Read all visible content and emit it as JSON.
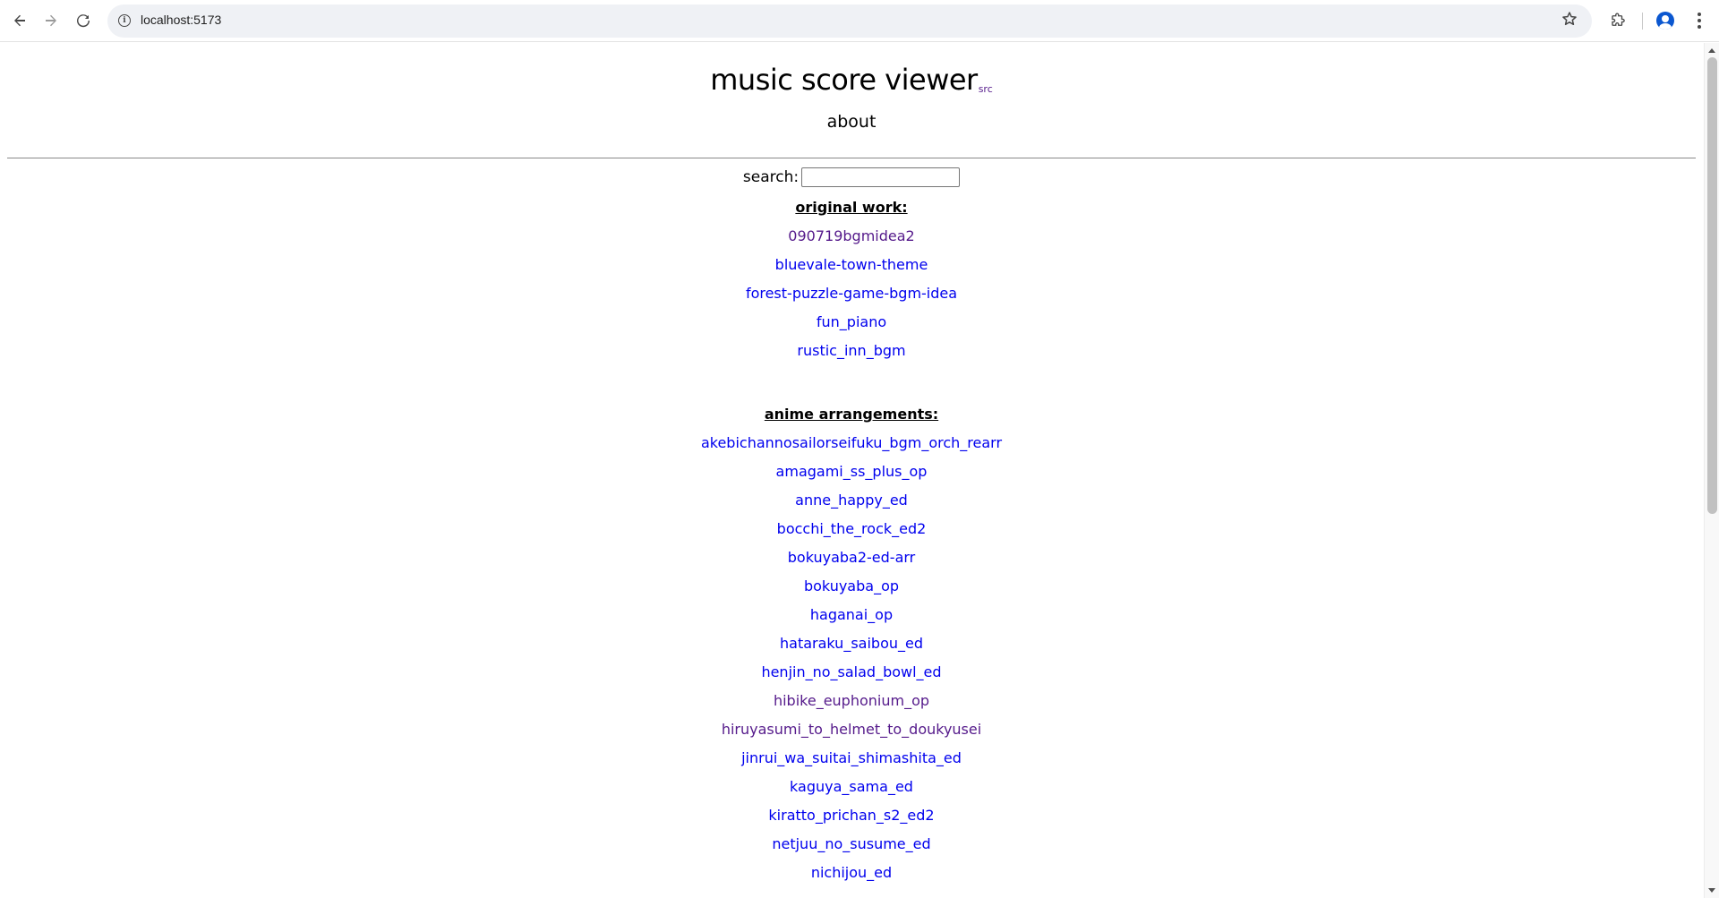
{
  "browser": {
    "url": "localhost:5173",
    "back_icon": "arrow-left-icon",
    "forward_icon": "arrow-right-icon",
    "reload_icon": "reload-icon",
    "bookmark_icon": "star-icon",
    "extensions_icon": "puzzle-icon",
    "profile_icon": "person-icon",
    "menu_icon": "kebab-icon"
  },
  "header": {
    "title": "music score viewer",
    "src_link": "src",
    "about_link": "about"
  },
  "search": {
    "label": "search:",
    "value": "",
    "placeholder": ""
  },
  "sections": [
    {
      "heading": "original work:",
      "items": [
        {
          "label": "090719bgmidea2",
          "visited": true
        },
        {
          "label": "bluevale-town-theme",
          "visited": false
        },
        {
          "label": "forest-puzzle-game-bgm-idea",
          "visited": false
        },
        {
          "label": "fun_piano",
          "visited": false
        },
        {
          "label": "rustic_inn_bgm",
          "visited": false
        }
      ]
    },
    {
      "heading": "anime arrangements:",
      "items": [
        {
          "label": "akebichannosailorseifuku_bgm_orch_rearr",
          "visited": false
        },
        {
          "label": "amagami_ss_plus_op",
          "visited": false
        },
        {
          "label": "anne_happy_ed",
          "visited": false
        },
        {
          "label": "bocchi_the_rock_ed2",
          "visited": false
        },
        {
          "label": "bokuyaba2-ed-arr",
          "visited": false
        },
        {
          "label": "bokuyaba_op",
          "visited": false
        },
        {
          "label": "haganai_op",
          "visited": false
        },
        {
          "label": "hataraku_saibou_ed",
          "visited": false
        },
        {
          "label": "henjin_no_salad_bowl_ed",
          "visited": false
        },
        {
          "label": "hibike_euphonium_op",
          "visited": true
        },
        {
          "label": "hiruyasumi_to_helmet_to_doukyusei",
          "visited": true
        },
        {
          "label": "jinrui_wa_suitai_shimashita_ed",
          "visited": false
        },
        {
          "label": "kaguya_sama_ed",
          "visited": false
        },
        {
          "label": "kiratto_prichan_s2_ed2",
          "visited": false
        },
        {
          "label": "netjuu_no_susume_ed",
          "visited": false
        },
        {
          "label": "nichijou_ed",
          "visited": false
        }
      ]
    }
  ],
  "colors": {
    "link": "#0000ee",
    "visited": "#551a8b"
  }
}
